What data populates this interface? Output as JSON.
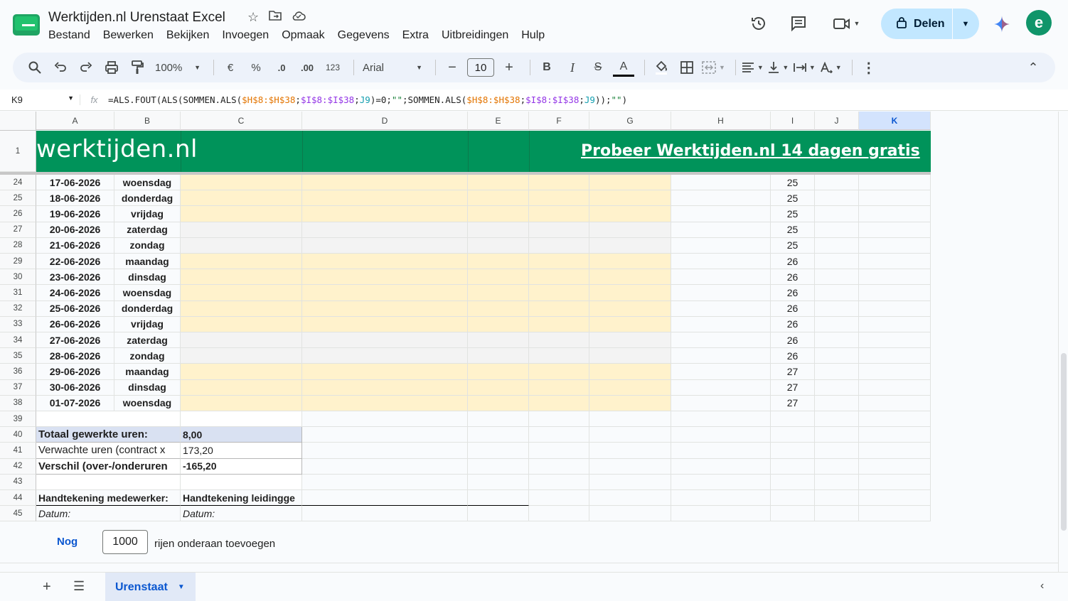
{
  "title": {
    "doc_name": "Werktijden.nl Urenstaat Excel",
    "icons": [
      "star-icon",
      "move-to-folder-icon",
      "cloud-status-icon"
    ]
  },
  "menu": [
    "Bestand",
    "Bewerken",
    "Bekijken",
    "Invoegen",
    "Opmaak",
    "Gegevens",
    "Extra",
    "Uitbreidingen",
    "Hulp"
  ],
  "header_actions": {
    "share_label": "Delen",
    "avatar_letter": "e",
    "icons": [
      "history-icon",
      "comments-icon",
      "meet-icon",
      "lock-icon",
      "gemini-icon"
    ]
  },
  "toolbar": {
    "zoom": "100%",
    "euro": "€",
    "percent": "%",
    "decimal_less": ".0",
    "decimal_more": ".00",
    "number_format": "123",
    "font": "Arial",
    "font_size": "10",
    "minus": "−",
    "plus": "+",
    "bold": "B",
    "italic": "I",
    "strike": "S",
    "textcolor": "A",
    "more": "⋮",
    "collapse": "⌃"
  },
  "formula_bar": {
    "cell_ref": "K9",
    "fx": "fx",
    "formula_parts": [
      {
        "t": "=ALS.FOUT(ALS(SOMMEN.ALS(",
        "c": ""
      },
      {
        "t": "$H$8:$H$38",
        "c": "f-orange"
      },
      {
        "t": ";",
        "c": ""
      },
      {
        "t": "$I$8:$I$38",
        "c": "f-purple"
      },
      {
        "t": ";",
        "c": ""
      },
      {
        "t": "J9",
        "c": "f-teal"
      },
      {
        "t": ")=0;",
        "c": ""
      },
      {
        "t": "\"\"",
        "c": "f-green"
      },
      {
        "t": ";SOMMEN.ALS(",
        "c": ""
      },
      {
        "t": "$H$8:$H$38",
        "c": "f-orange"
      },
      {
        "t": ";",
        "c": ""
      },
      {
        "t": "$I$8:$I$38",
        "c": "f-purple"
      },
      {
        "t": ";",
        "c": ""
      },
      {
        "t": "J9",
        "c": "f-teal"
      },
      {
        "t": "));",
        "c": ""
      },
      {
        "t": "\"\"",
        "c": "f-green"
      },
      {
        "t": ")",
        "c": ""
      }
    ]
  },
  "columns": [
    "A",
    "B",
    "C",
    "D",
    "E",
    "F",
    "G",
    "H",
    "I",
    "J",
    "K"
  ],
  "selected_column": "K",
  "banner": {
    "logo_text": "werktijden.nl",
    "link_text": "Probeer Werktijden.nl 14 dagen gratis"
  },
  "row1_label": "1",
  "date_rows": [
    {
      "row": "24",
      "date": "17-06-2026",
      "day": "woensdag",
      "week": "25",
      "weekend": false
    },
    {
      "row": "25",
      "date": "18-06-2026",
      "day": "donderdag",
      "week": "25",
      "weekend": false
    },
    {
      "row": "26",
      "date": "19-06-2026",
      "day": "vrijdag",
      "week": "25",
      "weekend": false
    },
    {
      "row": "27",
      "date": "20-06-2026",
      "day": "zaterdag",
      "week": "25",
      "weekend": true
    },
    {
      "row": "28",
      "date": "21-06-2026",
      "day": "zondag",
      "week": "25",
      "weekend": true
    },
    {
      "row": "29",
      "date": "22-06-2026",
      "day": "maandag",
      "week": "26",
      "weekend": false
    },
    {
      "row": "30",
      "date": "23-06-2026",
      "day": "dinsdag",
      "week": "26",
      "weekend": false
    },
    {
      "row": "31",
      "date": "24-06-2026",
      "day": "woensdag",
      "week": "26",
      "weekend": false
    },
    {
      "row": "32",
      "date": "25-06-2026",
      "day": "donderdag",
      "week": "26",
      "weekend": false
    },
    {
      "row": "33",
      "date": "26-06-2026",
      "day": "vrijdag",
      "week": "26",
      "weekend": false
    },
    {
      "row": "34",
      "date": "27-06-2026",
      "day": "zaterdag",
      "week": "26",
      "weekend": true
    },
    {
      "row": "35",
      "date": "28-06-2026",
      "day": "zondag",
      "week": "26",
      "weekend": true
    },
    {
      "row": "36",
      "date": "29-06-2026",
      "day": "maandag",
      "week": "27",
      "weekend": false
    },
    {
      "row": "37",
      "date": "30-06-2026",
      "day": "dinsdag",
      "week": "27",
      "weekend": false
    },
    {
      "row": "38",
      "date": "01-07-2026",
      "day": "woensdag",
      "week": "27",
      "weekend": false
    }
  ],
  "summary_rows": [
    {
      "row": "39",
      "label": "",
      "value": "",
      "bold": false
    },
    {
      "row": "40",
      "label": "Totaal gewerkte uren:",
      "value": "8,00",
      "bold": true
    },
    {
      "row": "41",
      "label": "Verwachte uren (contract x",
      "value": "173,20",
      "bold": false
    },
    {
      "row": "42",
      "label": "Verschil (over-/onderuren",
      "value": "-165,20",
      "bold": true
    },
    {
      "row": "43",
      "label": "",
      "value": "",
      "bold": false
    }
  ],
  "signature": {
    "row44": "44",
    "row45": "45",
    "employee": "Handtekening medewerker:",
    "manager": "Handtekening leidingge",
    "date_label": "Datum:"
  },
  "add_rows": {
    "nog": "Nog",
    "count": "1000",
    "label": "rijen onderaan toevoegen"
  },
  "sheet_tab": "Urenstaat"
}
